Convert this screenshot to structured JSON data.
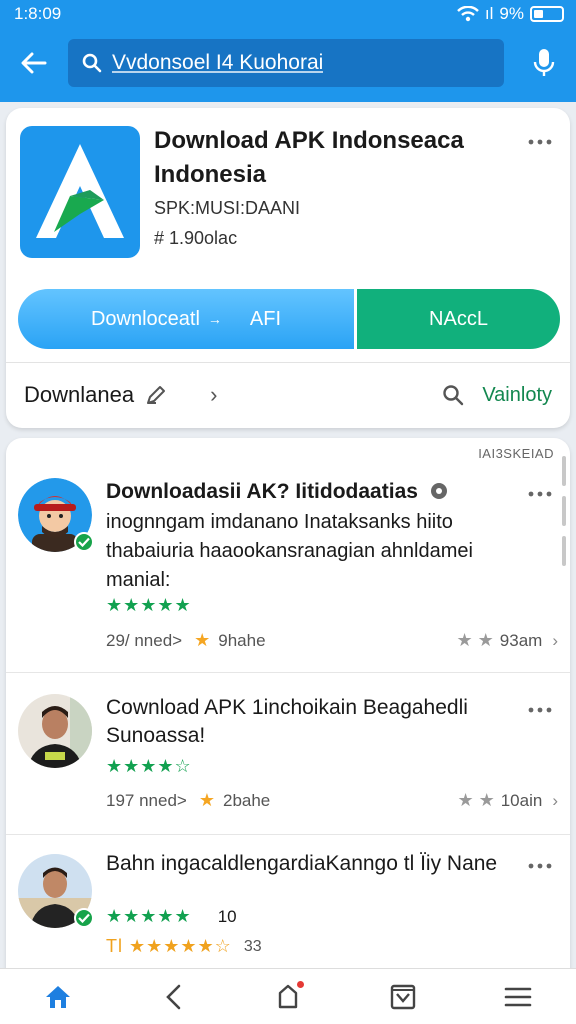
{
  "status_bar": {
    "time": "1:8:09",
    "signal_text": "ıl",
    "battery_text": "9%"
  },
  "search": {
    "query": "Vvdonsoel I4 Kuohorai"
  },
  "app": {
    "title": "Download APK Indonseaca Indonesia",
    "developer": "SPK:MUSI:DAANI",
    "size": "# 1.90olac",
    "download_label": "Downloceatl",
    "download_arrow": "→",
    "download_suffix": "AFI",
    "secondary_label": "NAccL"
  },
  "subheader": {
    "title": "Downlanea",
    "chevron": "›",
    "filter_label": "Vainloty"
  },
  "list": {
    "tag": "IAI3SKEIAD",
    "reviews": [
      {
        "title": "Downloadasii AK? Iitidodaatias",
        "body": "inognngam imdanano Inataksanks hiito thabaiuria haaookansranagian ahnldamei manial:",
        "stars": "★★★★★",
        "meta_left": "29/ nned>",
        "meta_center": "9hahe",
        "meta_right_stars": "★ ★",
        "meta_right": "93am",
        "chevron": "›"
      },
      {
        "title": "Cownload APK 1inchoikain Beagahedli Sunoassa!",
        "stars": "★★★★☆",
        "meta_left": "197 nned>",
        "meta_center": "2bahe",
        "meta_right_stars": "★ ★",
        "meta_right": "10ain",
        "chevron": "›"
      },
      {
        "title": "Bahn ingacaldlengardiaKanngo tl Ïiy Nane",
        "stars": "★★★★★",
        "stars_count": "10",
        "stars2": "★★★★★☆",
        "stars2_prefix": "Tl",
        "stars2_count": "33"
      }
    ]
  },
  "colors": {
    "header_blue": "#1e96ec",
    "search_box": "#1774c4",
    "download_blue": "#2aa3f5",
    "nav_green": "#11b07c",
    "star_green": "#12a150",
    "star_orange": "#f5a623",
    "filter_green": "#13874f"
  },
  "icons": {
    "back": "arrow-left-icon",
    "search": "search-icon",
    "mic": "mic-icon",
    "more": "more-horiz-icon",
    "edit": "pencil-icon",
    "home": "home-icon",
    "nav_back": "chevron-left-icon",
    "notes": "bookmark-icon",
    "tasks": "checkbox-icon",
    "menu": "menu-icon"
  }
}
